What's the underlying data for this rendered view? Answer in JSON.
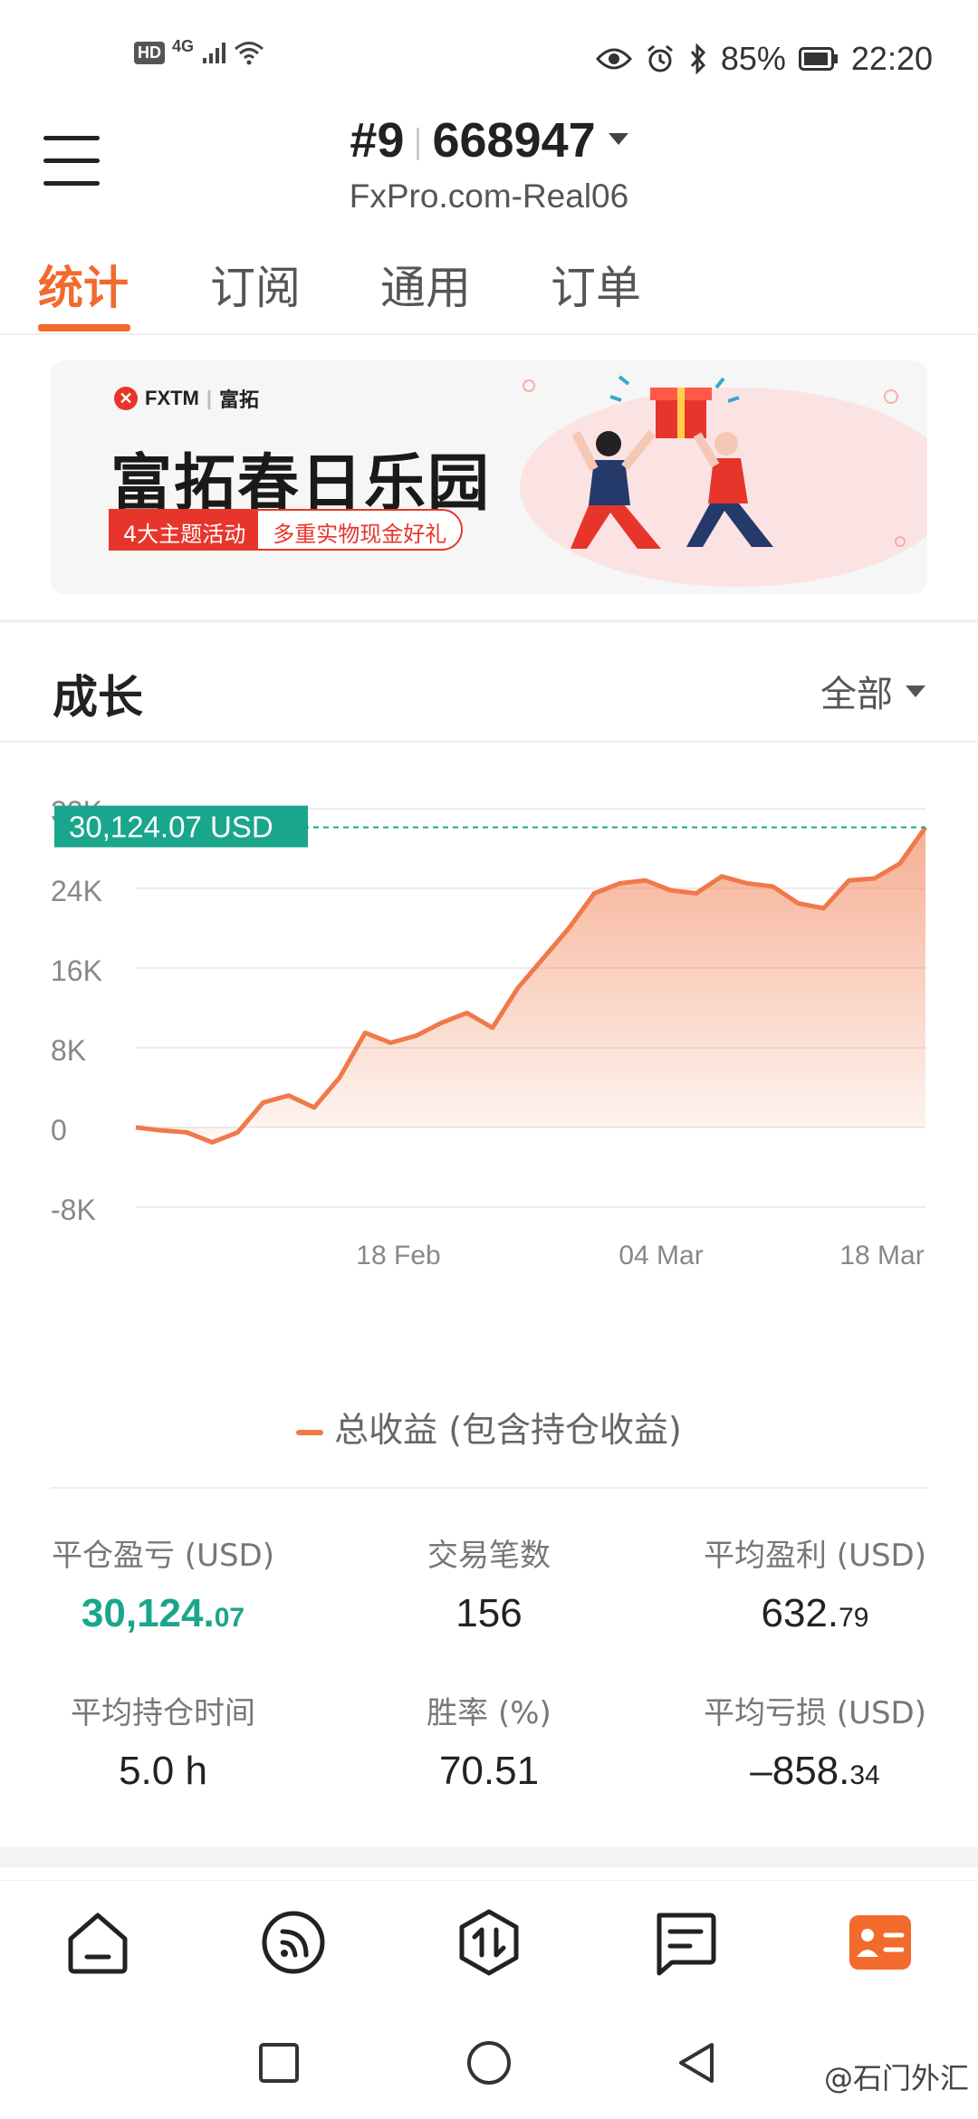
{
  "status_bar": {
    "hd": "HD",
    "network": "4G",
    "battery": "85%",
    "time": "22:20",
    "icons": [
      "signal-icon",
      "wifi-icon",
      "eye-icon",
      "alarm-icon",
      "bluetooth-icon",
      "battery-icon"
    ]
  },
  "header": {
    "account_rank": "#9",
    "account_number": "668947",
    "server": "FxPro.com-Real06"
  },
  "tabs": [
    {
      "label": "统计",
      "active": true
    },
    {
      "label": "订阅",
      "active": false
    },
    {
      "label": "通用",
      "active": false
    },
    {
      "label": "订单",
      "active": false
    }
  ],
  "banner": {
    "brand": "FXTM",
    "brand_cn": "富拓",
    "title": "富拓春日乐园",
    "tag_a": "4大主题活动",
    "tag_b": "多重实物现金好礼"
  },
  "growth": {
    "title": "成长",
    "filter": "全部"
  },
  "chart_data": {
    "type": "area",
    "y_ticks": [
      "32K",
      "24K",
      "16K",
      "8K",
      "0",
      "-8K"
    ],
    "ylim": [
      -8000,
      32000
    ],
    "x_ticks": [
      "18 Feb",
      "04 Mar",
      "18 Mar"
    ],
    "current_label": "30,124.07 USD",
    "current_value": 30124.07,
    "series": [
      {
        "name": "总收益 (包含持仓收益)",
        "color": "#f0794a",
        "values": [
          0,
          -300,
          -500,
          -1500,
          -500,
          2500,
          3200,
          2000,
          5000,
          9500,
          8500,
          9200,
          10500,
          11500,
          10000,
          14000,
          17000,
          20000,
          23500,
          24500,
          24800,
          23800,
          23500,
          25200,
          24500,
          24200,
          22500,
          22000,
          24800,
          25000,
          26500,
          30124
        ]
      }
    ],
    "legend": "总收益 (包含持仓收益)",
    "grid": true
  },
  "stats": [
    {
      "label": "平仓盈亏 (USD)",
      "value_main": "30,124.",
      "value_dec": "07",
      "highlight": true
    },
    {
      "label": "交易笔数",
      "value_main": "156",
      "value_dec": "",
      "highlight": false
    },
    {
      "label": "平均盈利 (USD)",
      "value_main": "632.",
      "value_dec": "79",
      "highlight": false
    },
    {
      "label": "平均持仓时间",
      "value_main": "5.0 h",
      "value_dec": "",
      "highlight": false
    },
    {
      "label": "胜率 (%)",
      "value_main": "70.51",
      "value_dec": "",
      "highlight": false
    },
    {
      "label": "平均亏损 (USD)",
      "value_main": "–858.",
      "value_dec": "34",
      "highlight": false
    }
  ],
  "bottom_nav": [
    "home-icon",
    "signal-feed-icon",
    "trade-icon",
    "message-icon",
    "profile-card-icon"
  ],
  "watermark": "@石门外汇",
  "colors": {
    "accent": "#f26a2c",
    "green": "#1aa68c",
    "line": "#f0794a"
  }
}
